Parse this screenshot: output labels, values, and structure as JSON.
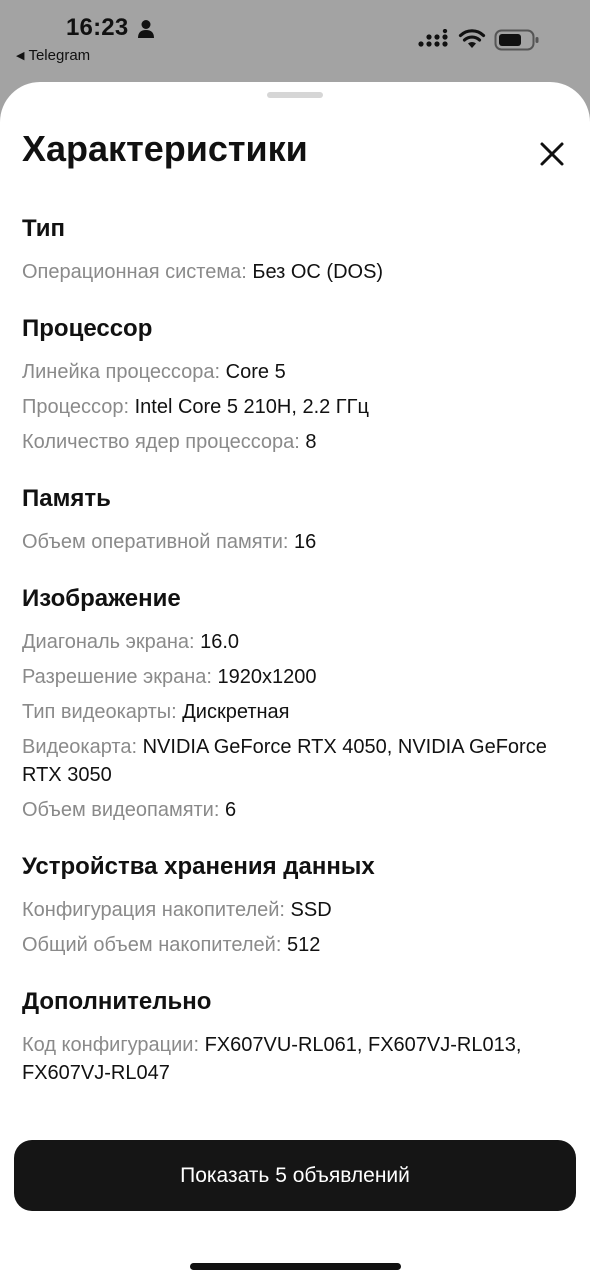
{
  "status_bar": {
    "time": "16:23",
    "back_app": "Telegram",
    "icons": [
      "person-icon",
      "signal-icon",
      "wifi-icon",
      "battery-icon"
    ]
  },
  "sheet": {
    "title": "Характеристики",
    "close_icon": "close-icon",
    "sections": [
      {
        "title": "Тип",
        "rows": [
          {
            "label": "Операционная система:",
            "value": "Без ОС (DOS)"
          }
        ]
      },
      {
        "title": "Процессор",
        "rows": [
          {
            "label": "Линейка процессора:",
            "value": "Core 5"
          },
          {
            "label": "Процессор:",
            "value": "Intel Core 5 210H, 2.2 ГГц"
          },
          {
            "label": "Количество ядер процессора:",
            "value": "8"
          }
        ]
      },
      {
        "title": "Память",
        "rows": [
          {
            "label": "Объем оперативной памяти:",
            "value": "16"
          }
        ]
      },
      {
        "title": "Изображение",
        "rows": [
          {
            "label": "Диагональ экрана:",
            "value": "16.0"
          },
          {
            "label": "Разрешение экрана:",
            "value": "1920x1200"
          },
          {
            "label": "Тип видеокарты:",
            "value": "Дискретная"
          },
          {
            "label": "Видеокарта:",
            "value": "NVIDIA GeForce RTX 4050, NVIDIA GeForce RTX 3050"
          },
          {
            "label": "Объем видеопамяти:",
            "value": "6"
          }
        ]
      },
      {
        "title": "Устройства хранения данных",
        "rows": [
          {
            "label": "Конфигурация накопителей:",
            "value": "SSD"
          },
          {
            "label": "Общий объем накопителей:",
            "value": "512"
          }
        ]
      },
      {
        "title": "Дополнительно",
        "rows": [
          {
            "label": "Код конфигурации:",
            "value": "FX607VU-RL061, FX607VJ-RL013, FX607VJ-RL047"
          }
        ]
      }
    ]
  },
  "action_button": {
    "label": "Показать 5 объявлений"
  }
}
